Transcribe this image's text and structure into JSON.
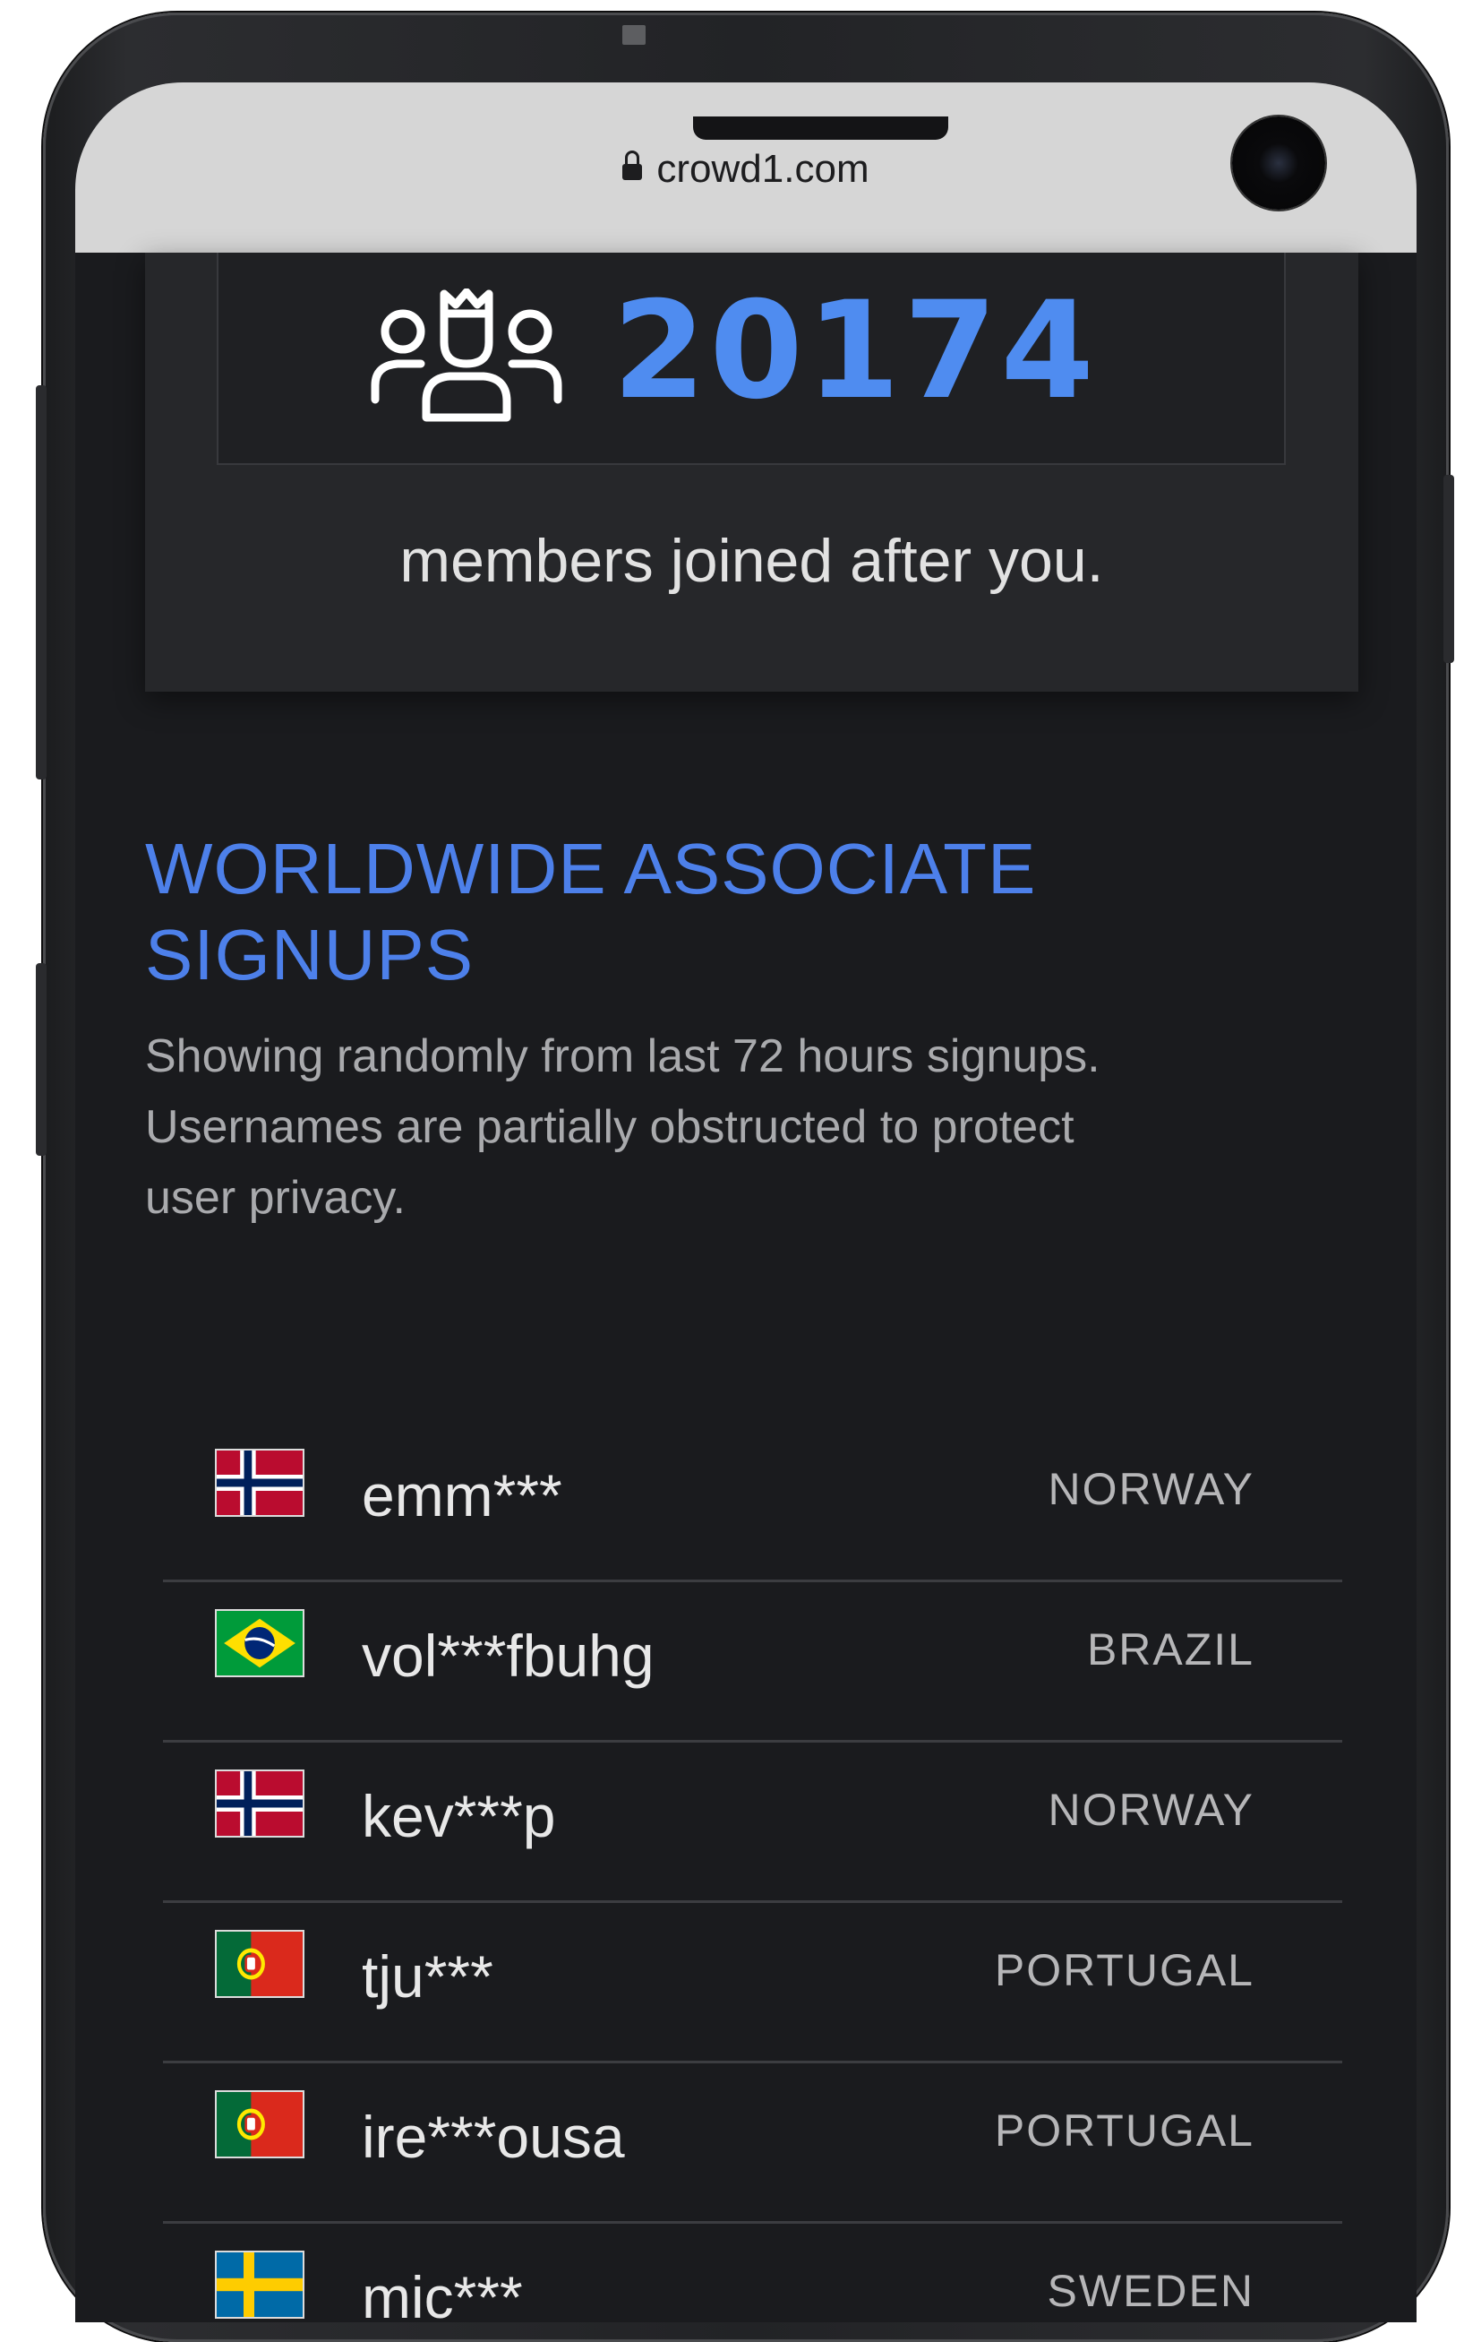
{
  "browser": {
    "url": "crowd1.com"
  },
  "members_counter": {
    "count": "20174",
    "caption": "members joined after you."
  },
  "signups_section": {
    "title_line1": "WORLDWIDE ASSOCIATE",
    "title_line2": "SIGNUPS",
    "description_line1": "Showing randomly from last 72 hours signups.",
    "description_line2": "Usernames are partially obstructed to protect",
    "description_line3": "user privacy.",
    "rows": [
      {
        "flag_icon": "norway-flag-icon",
        "username": "emm***",
        "country": "NORWAY"
      },
      {
        "flag_icon": "brazil-flag-icon",
        "username": "vol***fbuhg",
        "country": "BRAZIL"
      },
      {
        "flag_icon": "norway-flag-icon",
        "username": "kev***p",
        "country": "NORWAY"
      },
      {
        "flag_icon": "portugal-flag-icon",
        "username": "tju***",
        "country": "PORTUGAL"
      },
      {
        "flag_icon": "portugal-flag-icon",
        "username": "ire***ousa",
        "country": "PORTUGAL"
      },
      {
        "flag_icon": "sweden-flag-icon",
        "username": "mic***",
        "country": "SWEDEN"
      }
    ]
  },
  "colors": {
    "accent_blue": "#4d80ea",
    "counter_blue": "#4f8cf0",
    "page_background": "#1a1b1e",
    "panel_background": "#26272a"
  }
}
